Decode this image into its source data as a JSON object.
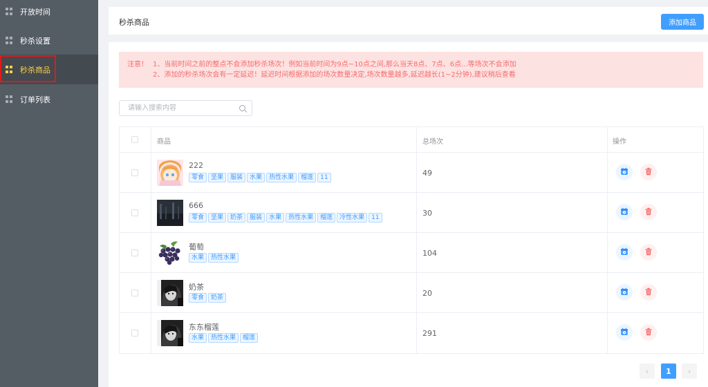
{
  "sidebar": {
    "items": [
      {
        "label": "开放时间",
        "active": false
      },
      {
        "label": "秒杀设置",
        "active": false
      },
      {
        "label": "秒杀商品",
        "active": true
      },
      {
        "label": "订单列表",
        "active": false
      }
    ]
  },
  "header": {
    "title": "秒杀商品",
    "add_button": "添加商品"
  },
  "notice": {
    "prefix": "注意！",
    "line1": "1、当前时间之前的整点不会添加秒杀场次！例如当前时间为9点~10点之间,那么当天8点、7点、6点...等场次不会添加",
    "line2": "2、添加的秒杀场次会有一定延迟！延迟时间根据添加的场次数量决定,场次数量越多,延迟越长(1~2分钟),建议稍后查看"
  },
  "search": {
    "placeholder": "请输入搜索内容",
    "value": ""
  },
  "table": {
    "headers": {
      "product": "商品",
      "total": "总场次",
      "ops": "操作"
    },
    "rows": [
      {
        "name": "222",
        "tags": [
          "零食",
          "坚果",
          "服装",
          "水果",
          "热性水果",
          "榴莲",
          "11"
        ],
        "total": "49",
        "thumb": "anime"
      },
      {
        "name": "666",
        "tags": [
          "零食",
          "坚果",
          "奶茶",
          "服装",
          "水果",
          "热性水果",
          "榴莲",
          "冷性水果",
          "11"
        ],
        "total": "30",
        "thumb": "dark"
      },
      {
        "name": "葡萄",
        "tags": [
          "水果",
          "热性水果"
        ],
        "total": "104",
        "thumb": "grape"
      },
      {
        "name": "奶茶",
        "tags": [
          "零食",
          "奶茶"
        ],
        "total": "20",
        "thumb": "portrait"
      },
      {
        "name": "东东榴莲",
        "tags": [
          "水果",
          "热性水果",
          "榴莲"
        ],
        "total": "291",
        "thumb": "portrait"
      }
    ]
  },
  "pagination": {
    "prev": "‹",
    "current": "1",
    "next": "›"
  },
  "colors": {
    "accent": "#409eff",
    "danger": "#f56c6c",
    "sidebar_bg": "#545c64",
    "active_text": "#ffd04b"
  }
}
